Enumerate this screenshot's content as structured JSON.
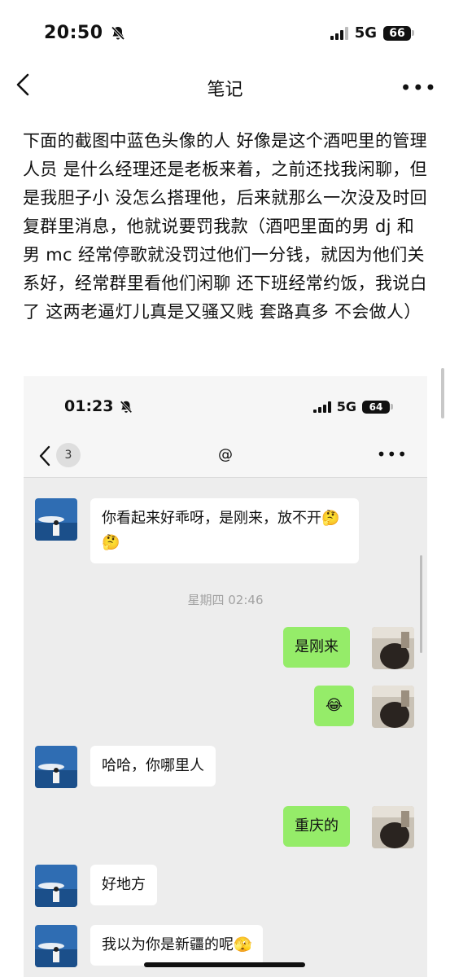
{
  "status_bar": {
    "time": "20:50",
    "network": "5G",
    "battery": "66"
  },
  "nav": {
    "title": "笔记"
  },
  "note": {
    "text": "下面的截图中蓝色头像的人 好像是这个酒吧里的管理人员  是什么经理还是老板来着，之前还找我闲聊，但是我胆子小 没怎么搭理他，后来就那么一次没及时回复群里消息，他就说要罚我款（酒吧里面的男 dj 和男 mc 经常停歌就没罚过他们一分钱，就因为他们关系好，经常群里看他们闲聊 还下班经常约饭，我说白了 这两老逼灯儿真是又骚又贱 套路真多 不会做人）"
  },
  "screenshot": {
    "status_bar": {
      "time": "01:23",
      "network": "5G",
      "battery": "64"
    },
    "nav": {
      "badge": "3",
      "title": "@"
    },
    "timestamp": "星期四 02:46",
    "messages": [
      {
        "side": "left",
        "text": "你看起来好乖呀，是刚来，放不开🤔🤔"
      },
      {
        "side": "right",
        "text": "是刚来"
      },
      {
        "side": "right",
        "text": "😂"
      },
      {
        "side": "left",
        "text": "哈哈，你哪里人"
      },
      {
        "side": "right",
        "text": "重庆的"
      },
      {
        "side": "left",
        "text": "好地方"
      },
      {
        "side": "left",
        "text": "我以为你是新疆的呢🫣"
      }
    ]
  },
  "colors": {
    "sent_bubble": "#95ec69",
    "chat_bg": "#ededed"
  }
}
